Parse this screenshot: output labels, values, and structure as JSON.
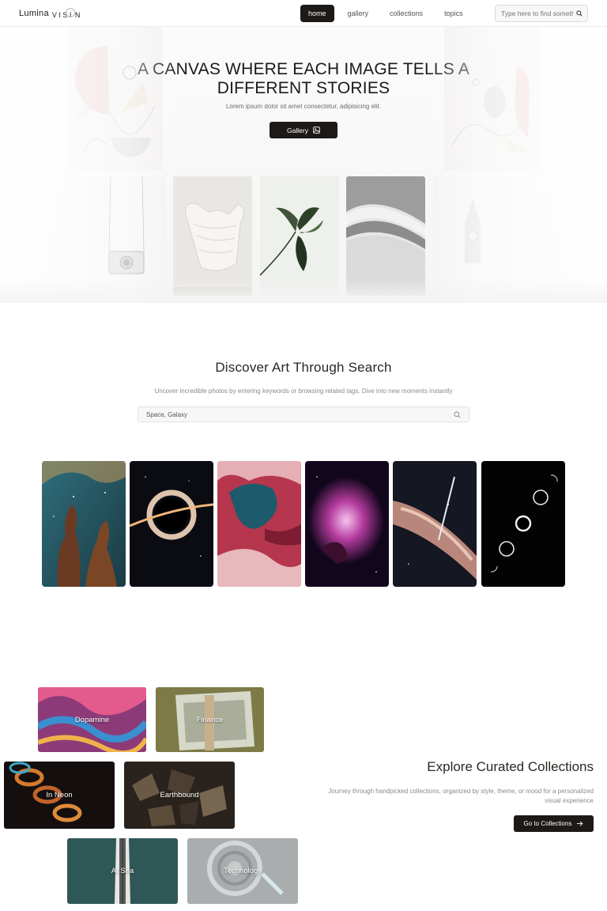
{
  "nav": {
    "logo_part1": "Lumina",
    "logo_part2": "VISI",
    "logo_part3": "N",
    "items": [
      {
        "label": "home",
        "active": true
      },
      {
        "label": "gallery",
        "active": false
      },
      {
        "label": "collections",
        "active": false
      },
      {
        "label": "topics",
        "active": false
      }
    ],
    "search_placeholder": "Type here to find something",
    "search_icon": "search-icon"
  },
  "hero": {
    "title_line1": "A CANVAS WHERE EACH IMAGE TELLS A",
    "title_line2": "DIFFERENT STORIES",
    "subtitle": "Lorem ipsum dolor sit amet consectetur, adipisicing elit.",
    "button_label": "Gallery",
    "button_icon": "image-icon"
  },
  "discover": {
    "title": "Discover Art Through Search",
    "subtitle": "Uncover incredible photos by entering keywords or browsing related tags. Dive into new moments instantly",
    "search_value": "Space, Galaxy",
    "search_icon": "search-icon"
  },
  "collections": {
    "title": "Explore Curated Collections",
    "subtitle_line1": "Journey through handpicked collections, organized by style, theme, or mood for a personalized",
    "subtitle_line2": "visual experience",
    "button_label": "Go to Collections",
    "button_icon": "arrow-right-icon",
    "cards": [
      {
        "label": "Dopamine"
      },
      {
        "label": "Finance"
      },
      {
        "label": "In Neon"
      },
      {
        "label": "Earthbound"
      },
      {
        "label": "At Sea"
      },
      {
        "label": "Technology"
      }
    ]
  },
  "colors": {
    "primary_dark": "#1c1917",
    "text_muted": "#8a8a8a",
    "border": "#e2e2e2"
  }
}
